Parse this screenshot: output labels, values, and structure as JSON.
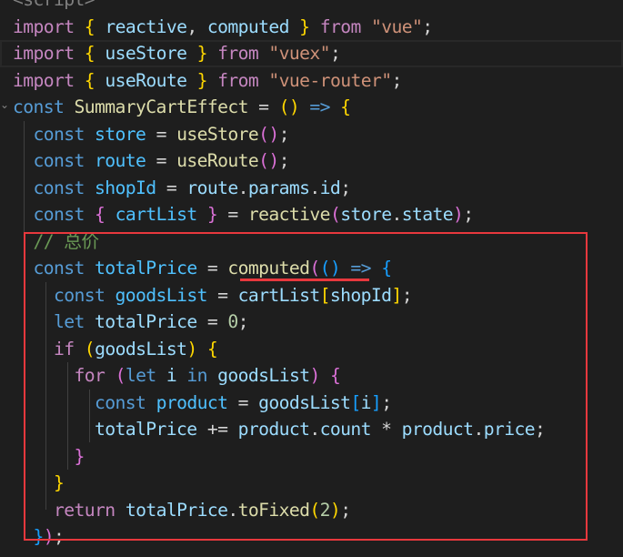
{
  "editor": {
    "colors": {
      "background": "#1e1e1e",
      "annotation": "#e8383d"
    },
    "lines": [
      [
        [
          "tag",
          "<script>"
        ]
      ],
      [
        [
          "kw",
          "import"
        ],
        [
          "p",
          " "
        ],
        [
          "b1",
          "{"
        ],
        [
          "var",
          " reactive"
        ],
        [
          "p",
          ", "
        ],
        [
          "var",
          "computed"
        ],
        [
          "p",
          " "
        ],
        [
          "b1",
          "}"
        ],
        [
          "p",
          " "
        ],
        [
          "kw",
          "from"
        ],
        [
          "p",
          " "
        ],
        [
          "str",
          "\"vue\""
        ],
        [
          "p",
          ";"
        ]
      ],
      [
        [
          "kw",
          "import"
        ],
        [
          "p",
          " "
        ],
        [
          "b1",
          "{"
        ],
        [
          "var",
          " useStore"
        ],
        [
          "p",
          " "
        ],
        [
          "b1",
          "}"
        ],
        [
          "p",
          " "
        ],
        [
          "kw",
          "from"
        ],
        [
          "p",
          " "
        ],
        [
          "str",
          "\"vuex\""
        ],
        [
          "p",
          ";"
        ]
      ],
      [
        [
          "kw",
          "import"
        ],
        [
          "p",
          " "
        ],
        [
          "b1",
          "{"
        ],
        [
          "var",
          " useRoute"
        ],
        [
          "p",
          " "
        ],
        [
          "b1",
          "}"
        ],
        [
          "p",
          " "
        ],
        [
          "kw",
          "from"
        ],
        [
          "p",
          " "
        ],
        [
          "str",
          "\"vue-router\""
        ],
        [
          "p",
          ";"
        ]
      ],
      [
        [
          "st",
          "const"
        ],
        [
          "p",
          " "
        ],
        [
          "fn",
          "SummaryCartEffect"
        ],
        [
          "p",
          " = "
        ],
        [
          "b1",
          "()"
        ],
        [
          "p",
          " "
        ],
        [
          "st",
          "=>"
        ],
        [
          "p",
          " "
        ],
        [
          "b1",
          "{"
        ]
      ],
      [
        [
          "p",
          "  "
        ],
        [
          "st",
          "const"
        ],
        [
          "p",
          " "
        ],
        [
          "cvar",
          "store"
        ],
        [
          "p",
          " = "
        ],
        [
          "fn",
          "useStore"
        ],
        [
          "b2",
          "()"
        ],
        [
          "p",
          ";"
        ]
      ],
      [
        [
          "p",
          "  "
        ],
        [
          "st",
          "const"
        ],
        [
          "p",
          " "
        ],
        [
          "cvar",
          "route"
        ],
        [
          "p",
          " = "
        ],
        [
          "fn",
          "useRoute"
        ],
        [
          "b2",
          "()"
        ],
        [
          "p",
          ";"
        ]
      ],
      [
        [
          "p",
          "  "
        ],
        [
          "st",
          "const"
        ],
        [
          "p",
          " "
        ],
        [
          "cvar",
          "shopId"
        ],
        [
          "p",
          " = "
        ],
        [
          "var",
          "route"
        ],
        [
          "p",
          "."
        ],
        [
          "var",
          "params"
        ],
        [
          "p",
          "."
        ],
        [
          "var",
          "id"
        ],
        [
          "p",
          ";"
        ]
      ],
      [
        [
          "p",
          "  "
        ],
        [
          "st",
          "const"
        ],
        [
          "p",
          " "
        ],
        [
          "b2",
          "{"
        ],
        [
          "p",
          " "
        ],
        [
          "cvar",
          "cartList"
        ],
        [
          "p",
          " "
        ],
        [
          "b2",
          "}"
        ],
        [
          "p",
          " = "
        ],
        [
          "fn",
          "reactive"
        ],
        [
          "b2",
          "("
        ],
        [
          "var",
          "store"
        ],
        [
          "p",
          "."
        ],
        [
          "var",
          "state"
        ],
        [
          "b2",
          ")"
        ],
        [
          "p",
          ";"
        ]
      ],
      [
        [
          "p",
          "  "
        ],
        [
          "cm",
          "// 总价"
        ]
      ],
      [
        [
          "p",
          "  "
        ],
        [
          "st",
          "const"
        ],
        [
          "p",
          " "
        ],
        [
          "cvar",
          "totalPrice"
        ],
        [
          "p",
          " = "
        ],
        [
          "fn",
          "computed"
        ],
        [
          "b2",
          "("
        ],
        [
          "b3",
          "()"
        ],
        [
          "p",
          " "
        ],
        [
          "st",
          "=>"
        ],
        [
          "p",
          " "
        ],
        [
          "b3",
          "{"
        ]
      ],
      [
        [
          "p",
          "    "
        ],
        [
          "st",
          "const"
        ],
        [
          "p",
          " "
        ],
        [
          "cvar",
          "goodsList"
        ],
        [
          "p",
          " = "
        ],
        [
          "var",
          "cartList"
        ],
        [
          "b1",
          "["
        ],
        [
          "var",
          "shopId"
        ],
        [
          "b1",
          "]"
        ],
        [
          "p",
          ";"
        ]
      ],
      [
        [
          "p",
          "    "
        ],
        [
          "st",
          "let"
        ],
        [
          "p",
          " "
        ],
        [
          "var",
          "totalPrice"
        ],
        [
          "p",
          " = "
        ],
        [
          "num",
          "0"
        ],
        [
          "p",
          ";"
        ]
      ],
      [
        [
          "p",
          "    "
        ],
        [
          "kw",
          "if"
        ],
        [
          "p",
          " "
        ],
        [
          "b1",
          "("
        ],
        [
          "var",
          "goodsList"
        ],
        [
          "b1",
          ")"
        ],
        [
          "p",
          " "
        ],
        [
          "b1",
          "{"
        ]
      ],
      [
        [
          "p",
          "      "
        ],
        [
          "kw",
          "for"
        ],
        [
          "p",
          " "
        ],
        [
          "b2",
          "("
        ],
        [
          "st",
          "let"
        ],
        [
          "p",
          " "
        ],
        [
          "var",
          "i"
        ],
        [
          "p",
          " "
        ],
        [
          "st",
          "in"
        ],
        [
          "p",
          " "
        ],
        [
          "var",
          "goodsList"
        ],
        [
          "b2",
          ")"
        ],
        [
          "p",
          " "
        ],
        [
          "b2",
          "{"
        ]
      ],
      [
        [
          "p",
          "        "
        ],
        [
          "st",
          "const"
        ],
        [
          "p",
          " "
        ],
        [
          "cvar",
          "product"
        ],
        [
          "p",
          " = "
        ],
        [
          "var",
          "goodsList"
        ],
        [
          "b3",
          "["
        ],
        [
          "var",
          "i"
        ],
        [
          "b3",
          "]"
        ],
        [
          "p",
          ";"
        ]
      ],
      [
        [
          "p",
          "        "
        ],
        [
          "var",
          "totalPrice"
        ],
        [
          "p",
          " += "
        ],
        [
          "var",
          "product"
        ],
        [
          "p",
          "."
        ],
        [
          "var",
          "count"
        ],
        [
          "p",
          " * "
        ],
        [
          "var",
          "product"
        ],
        [
          "p",
          "."
        ],
        [
          "var",
          "price"
        ],
        [
          "p",
          ";"
        ]
      ],
      [
        [
          "p",
          "      "
        ],
        [
          "b2",
          "}"
        ]
      ],
      [
        [
          "p",
          "    "
        ],
        [
          "b1",
          "}"
        ]
      ],
      [
        [
          "p",
          "    "
        ],
        [
          "kw",
          "return"
        ],
        [
          "p",
          " "
        ],
        [
          "var",
          "totalPrice"
        ],
        [
          "p",
          "."
        ],
        [
          "fn",
          "toFixed"
        ],
        [
          "b1",
          "("
        ],
        [
          "num",
          "2"
        ],
        [
          "b1",
          ")"
        ],
        [
          "p",
          ";"
        ]
      ],
      [
        [
          "p",
          "  "
        ],
        [
          "b3",
          "}"
        ],
        [
          "b2",
          ")"
        ],
        [
          "p",
          ";"
        ]
      ]
    ]
  }
}
